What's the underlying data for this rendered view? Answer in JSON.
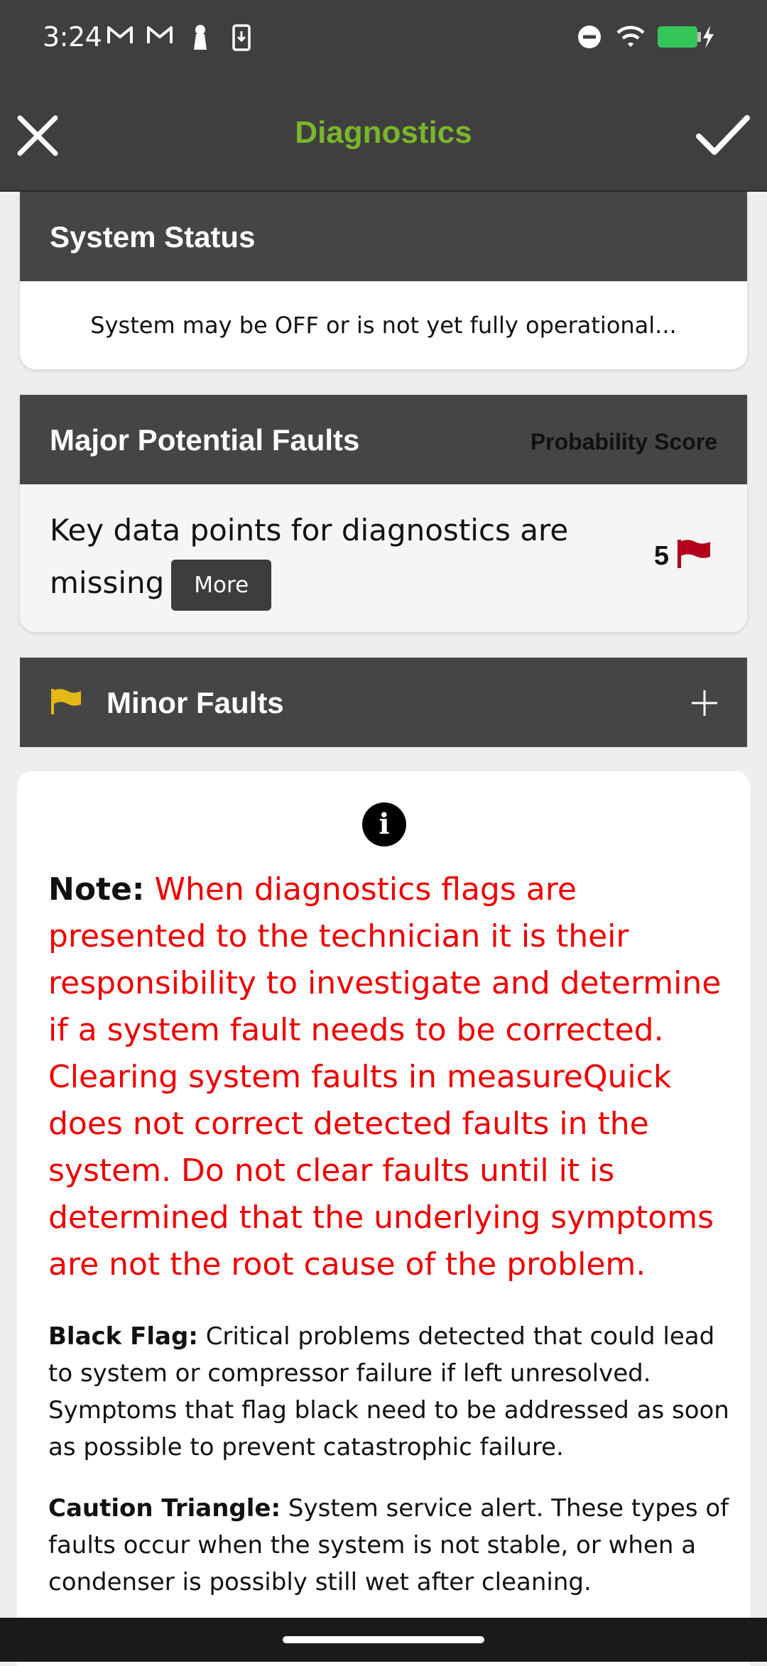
{
  "status_bar": {
    "time": "3:24"
  },
  "app_bar": {
    "title": "Diagnostics",
    "close_icon": "close-icon",
    "confirm_icon": "check-icon",
    "title_color": "#7ab52b"
  },
  "system_status": {
    "title": "System Status",
    "message": "System may be OFF or is not yet fully operational..."
  },
  "major_faults": {
    "title": "Major Potential Faults",
    "column_label": "Probability Score",
    "items": [
      {
        "text": "Key data points for diagnostics are missing",
        "more_label": "More",
        "score": "5",
        "flag_color": "#b3001b"
      }
    ]
  },
  "minor_faults": {
    "title": "Minor Faults",
    "flag_color": "#e6b817",
    "expand_icon": "plus-icon"
  },
  "note": {
    "label": "Note:",
    "text": "When diagnostics flags are presented to the technician it is their responsibility to investigate and determine if a system fault needs to be corrected. Clearing system faults in measureQuick does not correct detected faults in the system. Do not clear faults until it is determined that the underlying symptoms are not the root cause of the problem.",
    "text_color": "#ee0000"
  },
  "legend": [
    {
      "label": "Black Flag:",
      "text": "Critical problems detected that could lead to system or compressor failure if left unresolved. Symptoms that flag black need to be addressed as soon as possible to prevent catastrophic failure."
    },
    {
      "label": "Caution Triangle:",
      "text": "System service alert. These types of faults occur when the system is not stable, or when a condenser is possibly still wet after cleaning."
    }
  ]
}
